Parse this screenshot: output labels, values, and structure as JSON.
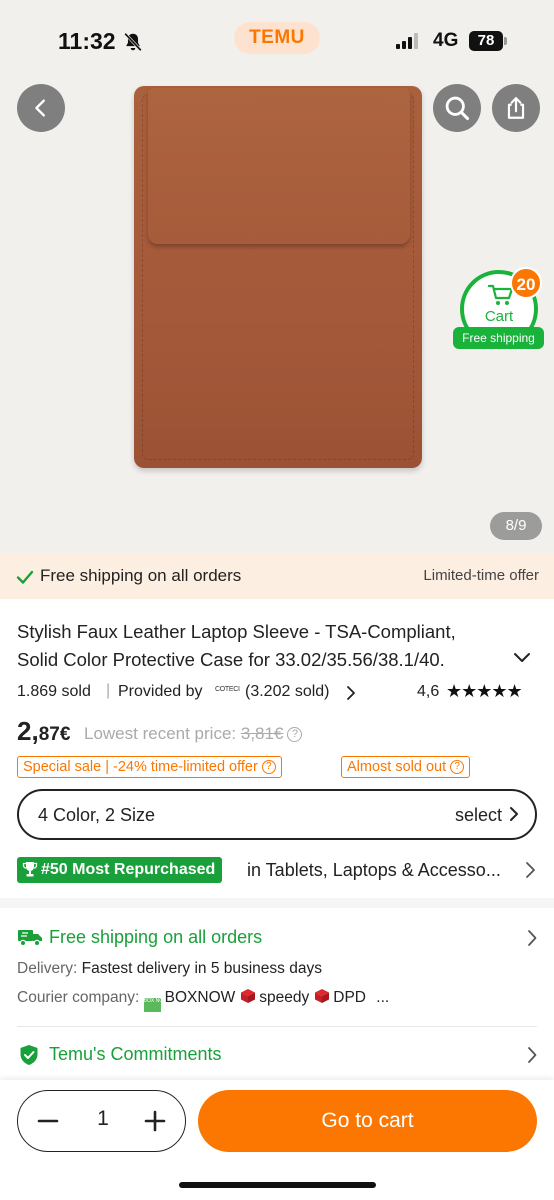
{
  "status_bar": {
    "time": "11:32",
    "app_badge": "TEMU",
    "network": "4G",
    "battery": "78"
  },
  "gallery": {
    "cart_label": "Cart",
    "cart_count": "20",
    "free_shipping_pill": "Free shipping",
    "image_counter": "8/9",
    "product_color": "#a65c3a"
  },
  "shipping_banner": {
    "text": "Free shipping on all orders",
    "offer": "Limited-time offer"
  },
  "product": {
    "title_line1": "Stylish Faux Leather Laptop Sleeve - TSA-Compliant,",
    "title_line2": "Solid Color Protective Case for 33.02/35.56/38.1/40.",
    "sold": "1.869 sold",
    "separator": "|",
    "provided_by": "Provided by",
    "store_logo_text": "COTECI",
    "store_sold": "(3.202 sold)",
    "rating": "4,6",
    "stars_display": "★★★★★",
    "rating_value": 4.6,
    "price_integer": "2,",
    "price_decimal": "87€",
    "lowest_label": "Lowest recent price:",
    "lowest_price": "3,81€",
    "tag_sale": "Special sale | -24% time-limited offer",
    "tag_soldout": "Almost sold out"
  },
  "variant_select": {
    "label": "4 Color, 2 Size",
    "action": "select"
  },
  "ranking": {
    "badge": "#50 Most Repurchased",
    "category": "in Tablets, Laptops & Accesso..."
  },
  "delivery": {
    "title": "Free shipping on all orders",
    "delivery_label": "Delivery:",
    "delivery_value": "Fastest delivery in 5 business days",
    "courier_label": "Courier company:",
    "boxnow_logo": "BOX NOW",
    "courier_1": "BOXNOW",
    "courier_2": "speedy",
    "courier_3": "DPD",
    "more": "..."
  },
  "commitments": {
    "label": "Temu's Commitments"
  },
  "bottom_bar": {
    "quantity": "1",
    "cta": "Go to cart"
  },
  "colors": {
    "brand_orange": "#fb7701",
    "success_green": "#19a03a",
    "cart_green": "#19b23b",
    "banner_bg": "#fdeee2"
  }
}
